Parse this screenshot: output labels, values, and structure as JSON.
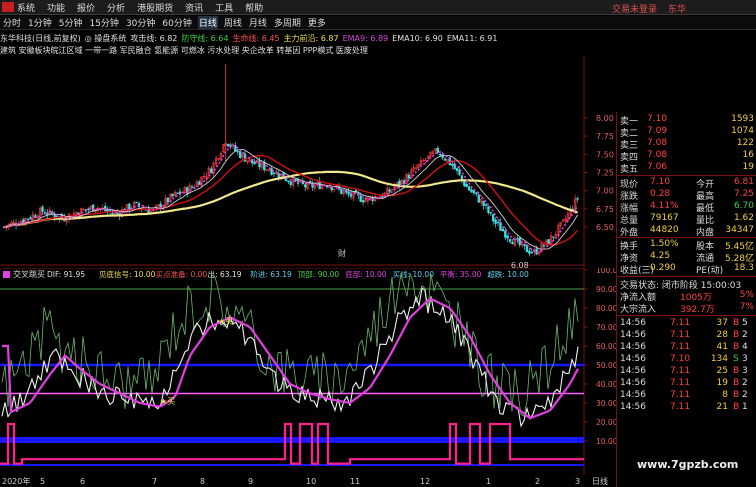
{
  "menubar": {
    "items": [
      "系统",
      "功能",
      "报价",
      "分析",
      "港股期货",
      "资讯",
      "工具",
      "帮助"
    ],
    "right_items": [
      "交易未登录",
      "东华"
    ]
  },
  "periods": {
    "items": [
      "分时",
      "1分钟",
      "5分钟",
      "15分钟",
      "30分钟",
      "60分钟",
      "日线",
      "周线",
      "月线",
      "多周期",
      "更多"
    ],
    "active": "日线"
  },
  "info": {
    "stock": "东华科技(日线,前复权)",
    "system": "◎ 操盘系统",
    "attack": "攻击线: 6.82",
    "defense": "防守线: 6.64",
    "life": "生命线: 6.45",
    "main": "主力前沿: 6.87",
    "ema9": "EMA9: 6.89",
    "ema10": "EMA10: 6.90",
    "ema11": "EMA11: 6.91",
    "concepts": "建筑    安徽板块皖江区域 一带一路 军民融合 氢能源 可燃冰 污水处理 央企改革 转基因 PPP模式 医废处理"
  },
  "subinfo": {
    "name": "交叉跳买",
    "items": [
      {
        "t": "DIF: 91.95",
        "c": "t-white"
      },
      {
        "t": "见底信号: 10.00",
        "c": "t-yellow"
      },
      {
        "t": "买点准备: 0.00",
        "c": "t-red"
      },
      {
        "t": "出: 63.19",
        "c": "t-white"
      },
      {
        "t": "阶进: 63.19",
        "c": "t-cyan"
      },
      {
        "t": "顶部: 90.00",
        "c": "t-green"
      },
      {
        "t": "底部: 10.00",
        "c": "t-magenta"
      },
      {
        "t": "买线: 10.00",
        "c": "t-cyan"
      },
      {
        "t": "平衡: 35.00",
        "c": "t-magenta"
      },
      {
        "t": "超跌: 10.00",
        "c": "t-cyan"
      }
    ]
  },
  "chart_labels": {
    "low_marker": "6.08",
    "cai": "财",
    "buy1": "★买",
    "buy2": "★买",
    "main_axis": [
      "8.00",
      "7.75",
      "7.50",
      "7.25",
      "7.00",
      "6.75",
      "6.50"
    ],
    "sub_axis": [
      "100.00",
      "90.00",
      "80.00",
      "70.00",
      "60.00",
      "50.00",
      "40.00",
      "30.00",
      "20.00",
      "10.00"
    ],
    "dates": [
      "2020年",
      "5",
      "6",
      "7",
      "8",
      "9",
      "10",
      "11",
      "12",
      "1",
      "2",
      "3"
    ],
    "tab": "日线",
    "watermark": "www.7gpzb.com"
  },
  "quotes": {
    "sells": [
      {
        "label": "卖一",
        "price": "7.10",
        "vol": "1593"
      },
      {
        "label": "卖二",
        "price": "7.09",
        "vol": "1074"
      },
      {
        "label": "卖三",
        "price": "7.08",
        "vol": "122"
      },
      {
        "label": "卖四",
        "price": "7.08",
        "vol": "16"
      },
      {
        "label": "卖五",
        "price": "7.06",
        "vol": "19"
      }
    ],
    "stats": [
      {
        "a": "现价",
        "av": "7.10",
        "b": "今开",
        "bv": "6.81"
      },
      {
        "a": "涨跌",
        "av": "0.28",
        "b": "最高",
        "bv": "7.25"
      },
      {
        "a": "涨幅",
        "av": "4.11%",
        "b": "最低",
        "bv": "6.70"
      },
      {
        "a": "总量",
        "av": "79167",
        "b": "量比",
        "bv": "1.62"
      },
      {
        "a": "外盘",
        "av": "44820",
        "b": "内盘",
        "bv": "34347"
      },
      {
        "a": "换手",
        "av": "1.50%",
        "b": "股本",
        "bv": "5.45亿"
      },
      {
        "a": "净资",
        "av": "4.25",
        "b": "流通",
        "bv": "5.28亿"
      },
      {
        "a": "收益(三)",
        "av": "0.290",
        "b": "PE(动)",
        "bv": "18.3"
      }
    ],
    "state": "交易状态: 闭市阶段 15:00:03",
    "flows": [
      {
        "label": "净流入额",
        "val": "1005万",
        "pct": "5%"
      },
      {
        "label": "大宗流入",
        "val": "392.7万",
        "pct": "7%"
      }
    ],
    "ticks": [
      {
        "t": "14:56",
        "p": "7.11",
        "v": "37",
        "d": "B",
        "n": "5"
      },
      {
        "t": "14:56",
        "p": "7.11",
        "v": "28",
        "d": "B",
        "n": "2"
      },
      {
        "t": "14:56",
        "p": "7.11",
        "v": "41",
        "d": "B",
        "n": "4"
      },
      {
        "t": "14:56",
        "p": "7.10",
        "v": "134",
        "d": "S",
        "n": "3"
      },
      {
        "t": "14:56",
        "p": "7.11",
        "v": "25",
        "d": "B",
        "n": "3"
      },
      {
        "t": "14:56",
        "p": "7.11",
        "v": "19",
        "d": "B",
        "n": "2"
      },
      {
        "t": "14:56",
        "p": "7.11",
        "v": "8",
        "d": "B",
        "n": "2"
      },
      {
        "t": "14:56",
        "p": "7.11",
        "v": "21",
        "d": "B",
        "n": "1"
      }
    ]
  },
  "colors": {
    "up": "#ff4040",
    "down": "#40e0e0",
    "yellow_ma": "#f0e68c",
    "red_ma": "#d01010",
    "magenta": "#e040e0",
    "blue": "#1818ff",
    "green": "#3a9a3a",
    "border": "#7a1010"
  }
}
